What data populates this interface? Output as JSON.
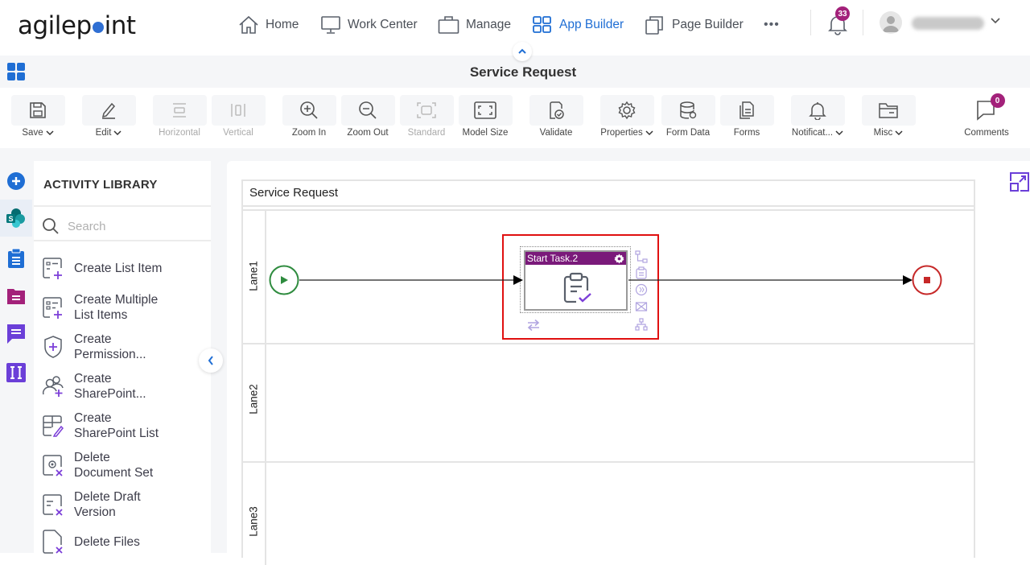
{
  "brand": {
    "logo_text_before": "agilep",
    "logo_text_after": "int"
  },
  "topnav": {
    "items": [
      {
        "label": "Home",
        "icon": "home-icon"
      },
      {
        "label": "Work Center",
        "icon": "monitor-icon"
      },
      {
        "label": "Manage",
        "icon": "briefcase-icon"
      },
      {
        "label": "App Builder",
        "icon": "app-builder-icon",
        "active": true
      },
      {
        "label": "Page Builder",
        "icon": "page-builder-icon"
      }
    ],
    "more_label": "•••",
    "notifications_count": "33",
    "colors": {
      "active": "#1f6ed4",
      "badge": "#a3217a"
    }
  },
  "titlebar": {
    "title": "Service Request"
  },
  "toolbar": {
    "items": [
      {
        "label": "Save",
        "icon": "save-icon",
        "dropdown": true
      },
      {
        "label": "Edit",
        "icon": "edit-icon",
        "dropdown": true
      },
      {
        "label": "Horizontal",
        "icon": "horizontal-icon",
        "disabled": true
      },
      {
        "label": "Vertical",
        "icon": "vertical-icon",
        "disabled": true
      },
      {
        "label": "Zoom In",
        "icon": "zoom-in-icon"
      },
      {
        "label": "Zoom Out",
        "icon": "zoom-out-icon"
      },
      {
        "label": "Standard",
        "icon": "standard-icon",
        "disabled": true
      },
      {
        "label": "Model Size",
        "icon": "model-size-icon"
      },
      {
        "label": "Validate",
        "icon": "validate-icon"
      },
      {
        "label": "Properties",
        "icon": "gear-icon",
        "dropdown": true
      },
      {
        "label": "Form Data",
        "icon": "database-icon"
      },
      {
        "label": "Forms",
        "icon": "forms-icon"
      },
      {
        "label": "Notificat...",
        "icon": "bell-icon",
        "dropdown": true
      },
      {
        "label": "Misc",
        "icon": "folder-icon",
        "dropdown": true
      },
      {
        "label": "Comments",
        "icon": "comment-icon",
        "badge": "0"
      }
    ]
  },
  "library": {
    "title": "ACTIVITY LIBRARY",
    "search_placeholder": "Search",
    "items": [
      {
        "line1": "Create List Item",
        "line2": ""
      },
      {
        "line1": "Create Multiple",
        "line2": "List Items"
      },
      {
        "line1": "Create",
        "line2": "Permission..."
      },
      {
        "line1": "Create",
        "line2": "SharePoint..."
      },
      {
        "line1": "Create",
        "line2": "SharePoint List"
      },
      {
        "line1": "Delete",
        "line2": "Document Set"
      },
      {
        "line1": "Delete Draft",
        "line2": "Version"
      },
      {
        "line1": "Delete Files",
        "line2": ""
      }
    ]
  },
  "rail": {
    "items": [
      {
        "icon": "add-icon",
        "color": "#1f6ed4"
      },
      {
        "icon": "sharepoint-icon",
        "color": "#038387",
        "active": true
      },
      {
        "icon": "clipboard-icon",
        "color": "#1f6ed4"
      },
      {
        "icon": "folder-doc-icon",
        "color": "#a3217a"
      },
      {
        "icon": "chat-icon",
        "color": "#6b3fd8"
      },
      {
        "icon": "text-field-icon",
        "color": "#6b3fd8"
      }
    ]
  },
  "process": {
    "pool_title": "Service Request",
    "lanes": [
      "Lane1",
      "Lane2",
      "Lane3"
    ],
    "task": {
      "title": "Start Task.2",
      "header_color": "#7a1a7a"
    },
    "start_event_color": "#2e8b3e",
    "end_event_color": "#c62828",
    "selection_color": "#e01010"
  }
}
